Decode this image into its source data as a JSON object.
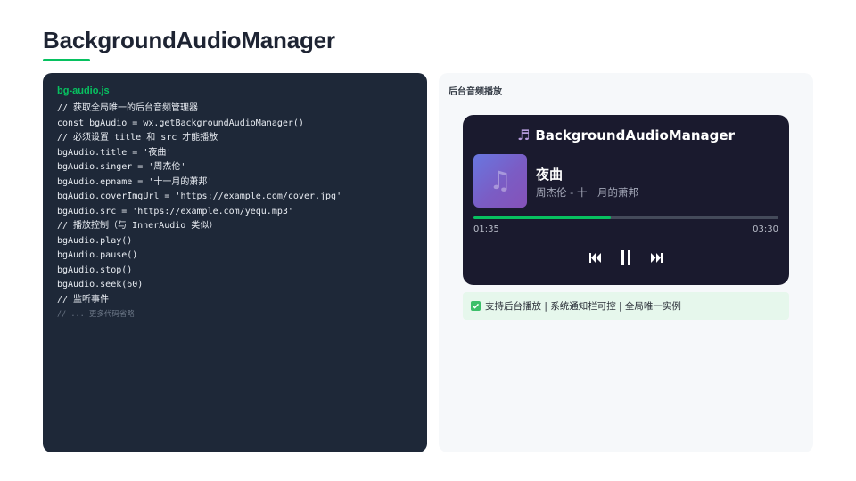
{
  "page": {
    "title": "BackgroundAudioManager",
    "accent_color": "#07c160"
  },
  "code": {
    "filename": "bg-audio.js",
    "lines": [
      "// 获取全局唯一的后台音频管理器",
      "const bgAudio = wx.getBackgroundAudioManager()",
      "// 必须设置 title 和 src 才能播放",
      "bgAudio.title = '夜曲'",
      "bgAudio.singer = '周杰伦'",
      "bgAudio.epname = '十一月的萧邦'",
      "bgAudio.coverImgUrl = 'https://example.com/cover.jpg'",
      "bgAudio.src = 'https://example.com/yequ.mp3'",
      "// 播放控制（与 InnerAudio 类似）",
      "bgAudio.play()",
      "bgAudio.pause()",
      "bgAudio.stop()",
      "bgAudio.seek(60)",
      "// 监听事件",
      "// ... 更多代码省略"
    ]
  },
  "preview": {
    "label": "后台音频播放",
    "player": {
      "header_icon": "music-note-icon",
      "header_title": "BackgroundAudioManager",
      "song_title": "夜曲",
      "song_meta": "周杰伦 - 十一月的萧邦",
      "current_time": "01:35",
      "total_time": "03:30",
      "progress_fraction": 0.45,
      "controls": [
        "skip-previous-icon",
        "pause-icon",
        "skip-next-icon"
      ]
    },
    "support_text": "支持后台播放 | 系统通知栏可控 | 全局唯一实例"
  }
}
